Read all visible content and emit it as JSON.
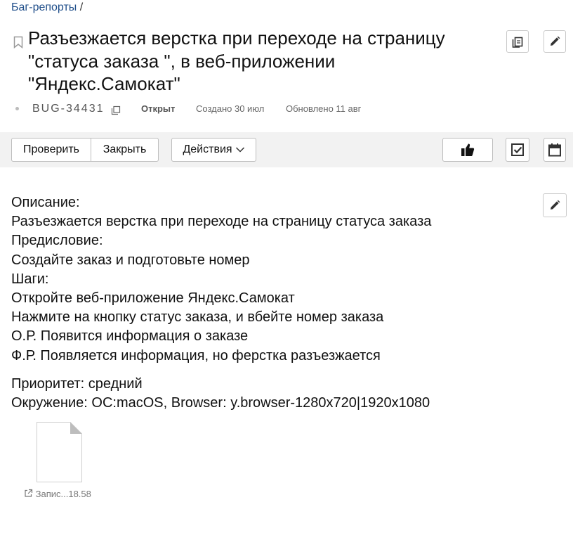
{
  "breadcrumb": {
    "link": "Баг-репорты",
    "separator": "/"
  },
  "issue": {
    "title": "Разъезжается верстка при переходе на страницу \"статуса заказа \", в веб-приложении \"Яндекс.Самокат\"",
    "key": "BUG-34431",
    "status": "Открыт",
    "created": "Создано 30 июл",
    "updated": "Обновлено 11 авг"
  },
  "toolbar": {
    "check_label": "Проверить",
    "close_label": "Закрыть",
    "actions_label": "Действия"
  },
  "description": {
    "lines": [
      "Описание:",
      "Разъезжается верстка при переходе на страницу статуса заказа",
      "Предисловие:",
      "Создайте заказ и подготовьте номер",
      "Шаги:",
      "Откройте веб-приложение Яндекс.Самокат",
      "Нажмите на кнопку статус заказа, и вбейте номер заказа",
      "О.Р. Появится информация о заказе",
      "Ф.Р. Появляется информация, но ферстка разъезжается"
    ],
    "priority": "Приоритет: средний",
    "environment": "Окружение: ОС:macOS, Browser: y.browser-1280x720|1920x1080"
  },
  "attachment": {
    "name": "Запис...18.58"
  },
  "colors": {
    "link": "#1f4e8a",
    "toolbar_bg": "#f2f2f2",
    "border": "#bdbdbd"
  }
}
